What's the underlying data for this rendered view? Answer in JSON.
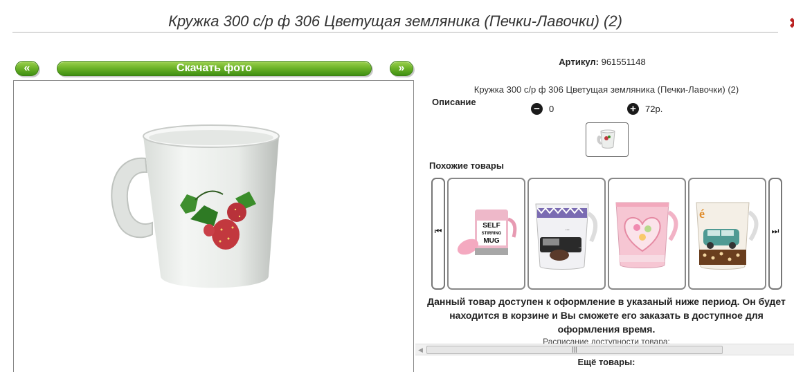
{
  "header": {
    "title": "Кружка 300 с/р ф 306 Цветущая земляника (Печки-Лавочки) (2)",
    "close_glyph": "✖"
  },
  "gallery": {
    "prev_label": "«",
    "download_label": "Скачать фото",
    "next_label": "»"
  },
  "product": {
    "article_label": "Артикул:",
    "article_value": "961551148",
    "name": "Кружка 300 с/р ф 306 Цветущая земляника (Печки-Лавочки) (2)",
    "description_label": "Описание",
    "qty_minus_icon": "minus-circle-icon",
    "qty_value": "0",
    "qty_plus_icon": "plus-circle-icon",
    "price": "72р."
  },
  "similar": {
    "label": "Похожие товары",
    "prev_glyph": "⏮",
    "next_glyph": "⏭",
    "items": [
      {
        "image": "self-stirring-mug",
        "print_lines": [
          "SELF",
          "STIRRING",
          "MUG"
        ]
      },
      {
        "image": "car-pattern-mug",
        "print_lines": [
          "...",
          "..."
        ]
      },
      {
        "image": "heart-pink-mug",
        "print_lines": []
      },
      {
        "image": "retro-car-mug",
        "print_lines": [
          "é"
        ]
      }
    ]
  },
  "availability": {
    "text": "Данный товар доступен к оформление в указаный ниже период. Он будет находится в корзине и Вы сможете его заказать в доступное для оформления время.",
    "schedule_label": "Расписание доступности товара:"
  },
  "scrollbar": {
    "left_arrow": "◀",
    "grip": "|||"
  },
  "more": {
    "label": "Ещё товары:"
  },
  "colors": {
    "button_green": "#6fb42a",
    "close_red": "#b22222"
  }
}
